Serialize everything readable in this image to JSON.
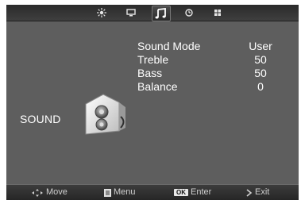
{
  "top_icons": [
    {
      "name": "picture-icon",
      "active": false
    },
    {
      "name": "channel-icon",
      "active": false
    },
    {
      "name": "sound-icon",
      "active": true
    },
    {
      "name": "time-icon",
      "active": false
    },
    {
      "name": "setup-icon",
      "active": false
    }
  ],
  "section": {
    "title": "SOUND",
    "icon": "speaker-icon"
  },
  "menu": [
    {
      "label": "Sound Mode",
      "value": "User"
    },
    {
      "label": "Treble",
      "value": "50"
    },
    {
      "label": "Bass",
      "value": "50"
    },
    {
      "label": "Balance",
      "value": "0"
    }
  ],
  "bottom": {
    "move": "Move",
    "menu": "Menu",
    "ok_badge": "OK",
    "enter": "Enter",
    "exit": "Exit"
  }
}
